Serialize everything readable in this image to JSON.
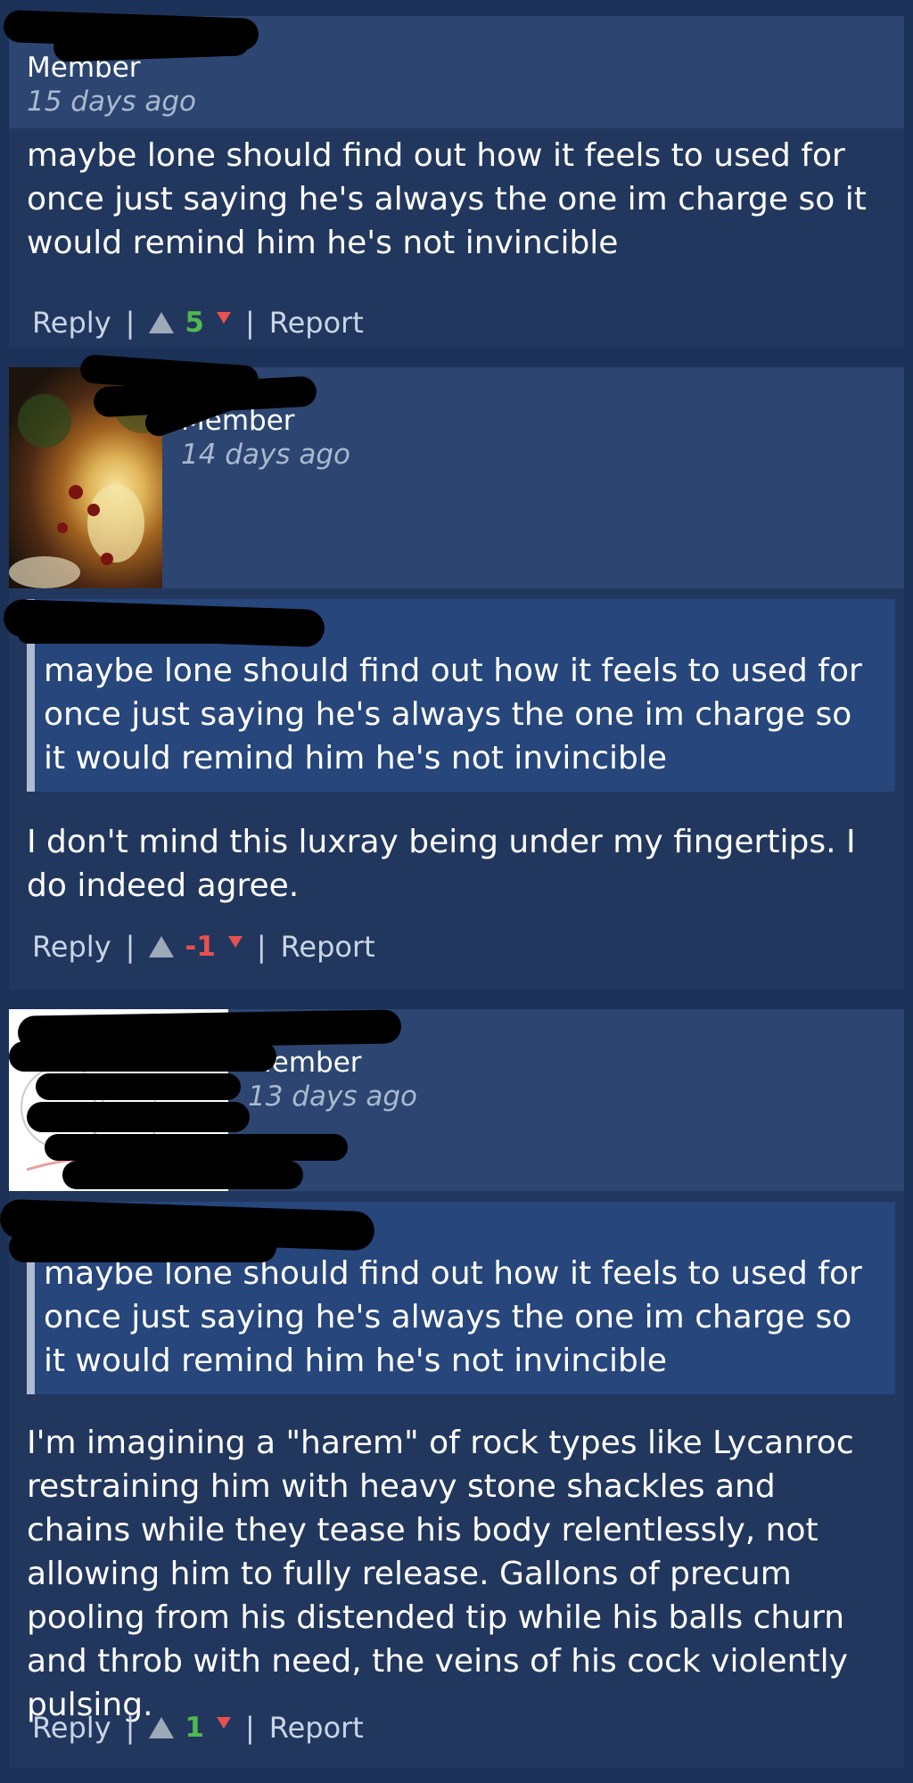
{
  "colors": {
    "page_bg": "#1b3157",
    "card_bg": "#22375e",
    "header_bg": "#2c4671",
    "quote_bg": "#26467c",
    "positive": "#4fb84f",
    "negative": "#e8514f"
  },
  "comments": [
    {
      "role": "Member",
      "time": "15 days ago",
      "text": "maybe lone should find out how it feels to used for once just saying he's always the one im charge so it would remind him he's not invincible",
      "actions": {
        "reply": "Reply",
        "score": "5",
        "report": "Report"
      }
    },
    {
      "role": "Member",
      "time": "14 days ago",
      "quote": "maybe lone should find out how it feels to used for once just saying he's always the one im charge so it would remind him he's not invincible",
      "text": "I don't mind this luxray being under my fingertips. I do indeed agree.",
      "actions": {
        "reply": "Reply",
        "score": "-1",
        "report": "Report"
      }
    },
    {
      "role": "Member",
      "time": "13 days ago",
      "quote": "maybe lone should find out how it feels to used for once just saying he's always the one im charge so it would remind him he's not invincible",
      "text": "I'm imagining a \"harem\" of rock types like Lycanroc restraining him with heavy stone shackles and chains while they tease his body relentlessly, not allowing him to fully release. Gallons of precum pooling from his distended tip while his balls churn and throb with need, the veins of his cock violently pulsing.",
      "actions": {
        "reply": "Reply",
        "score": "1",
        "report": "Report"
      }
    }
  ]
}
